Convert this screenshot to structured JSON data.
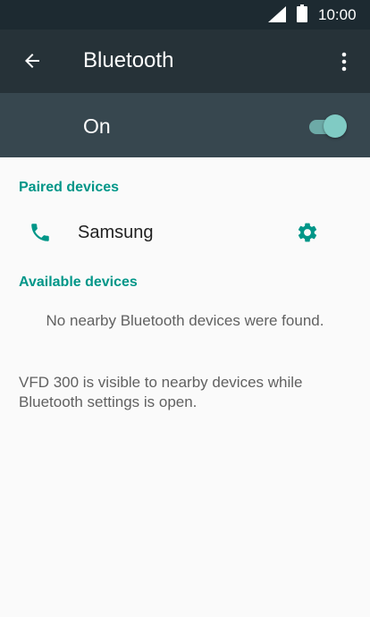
{
  "status_bar": {
    "time": "10:00",
    "icons": [
      "signal-icon",
      "battery-icon"
    ]
  },
  "app_bar": {
    "back_icon": "arrow-back-icon",
    "title": "Bluetooth",
    "menu_icon": "more-vert-icon"
  },
  "switch_bar": {
    "label": "On",
    "checked": true
  },
  "paired": {
    "header": "Paired devices",
    "devices": [
      {
        "icon": "phone-icon",
        "name": "Samsung",
        "settings_icon": "gear-icon"
      }
    ]
  },
  "available": {
    "header": "Available devices",
    "empty_message": "No nearby Bluetooth devices were found."
  },
  "visibility_note": "VFD 300 is visible to nearby devices while Bluetooth settings is open.",
  "colors": {
    "status_bar": "#1d2a31",
    "app_bar": "#263238",
    "switch_bar": "#37474f",
    "accent": "#009688",
    "toggle": "#80cbc4",
    "background": "#fafafa"
  }
}
